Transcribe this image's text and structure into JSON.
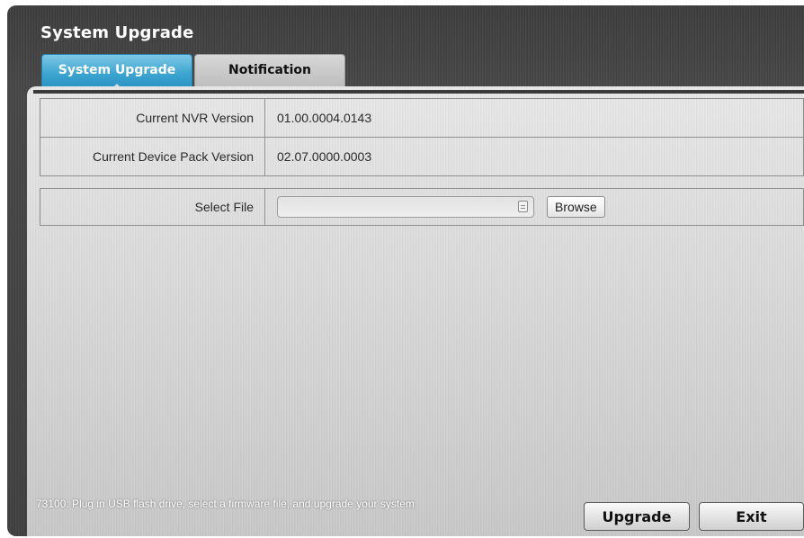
{
  "window": {
    "title": "System Upgrade"
  },
  "tabs": [
    {
      "label": "System Upgrade",
      "active": true
    },
    {
      "label": "Notification",
      "active": false
    }
  ],
  "info_rows": [
    {
      "label": "Current NVR Version",
      "value": "01.00.0004.0143"
    },
    {
      "label": "Current Device Pack Version",
      "value": "02.07.0000.0003"
    }
  ],
  "select_file": {
    "label": "Select File",
    "value": "",
    "icon": "file-list-icon",
    "browse_label": "Browse"
  },
  "status_message": "73100: Plug in USB flash drive, select a firmware file, and upgrade your system.",
  "buttons": {
    "upgrade": "Upgrade",
    "exit": "Exit"
  },
  "colors": {
    "active_tab": "#3aa3cf",
    "window_background": "#3e3e3e",
    "panel_background": "#d9d9d9"
  }
}
